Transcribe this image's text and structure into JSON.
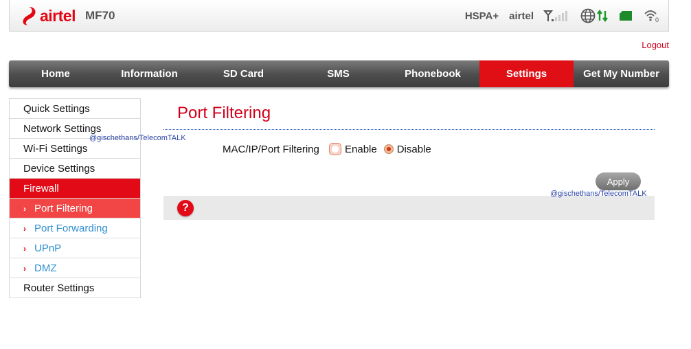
{
  "header": {
    "brand": "airtel",
    "model": "MF70",
    "network_type": "HSPA+",
    "operator": "airtel",
    "wifi_clients": "0",
    "icons": [
      "airtel-logo",
      "signal-icon",
      "globe-icon",
      "data-arrows-icon",
      "sim-icon",
      "wifi-icon"
    ]
  },
  "logout_label": "Logout",
  "nav": {
    "items": [
      {
        "label": "Home"
      },
      {
        "label": "Information"
      },
      {
        "label": "SD Card"
      },
      {
        "label": "SMS"
      },
      {
        "label": "Phonebook"
      },
      {
        "label": "Settings"
      },
      {
        "label": "Get My Number"
      }
    ],
    "active": "Settings"
  },
  "sidebar": {
    "items": [
      {
        "label": "Quick Settings"
      },
      {
        "label": "Network Settings"
      },
      {
        "label": "Wi-Fi Settings"
      },
      {
        "label": "Device Settings"
      },
      {
        "label": "Firewall"
      },
      {
        "label": "Port Filtering"
      },
      {
        "label": "Port Forwarding"
      },
      {
        "label": "UPnP"
      },
      {
        "label": "DMZ"
      },
      {
        "label": "Router Settings"
      }
    ],
    "active_sub": "Port Filtering",
    "sub_marker": "›"
  },
  "main": {
    "title": "Port Filtering",
    "field_label": "MAC/IP/Port Filtering",
    "options": [
      {
        "label": "Enable"
      },
      {
        "label": "Disable"
      }
    ],
    "selected": "Disable",
    "apply_label": "Apply",
    "help_symbol": "?"
  },
  "watermark": "@gischethans/TelecomTALK",
  "colors": {
    "brand_red": "#e20a16",
    "link_blue": "#2e8fd0",
    "nav_dark": "#4f4f4f"
  }
}
